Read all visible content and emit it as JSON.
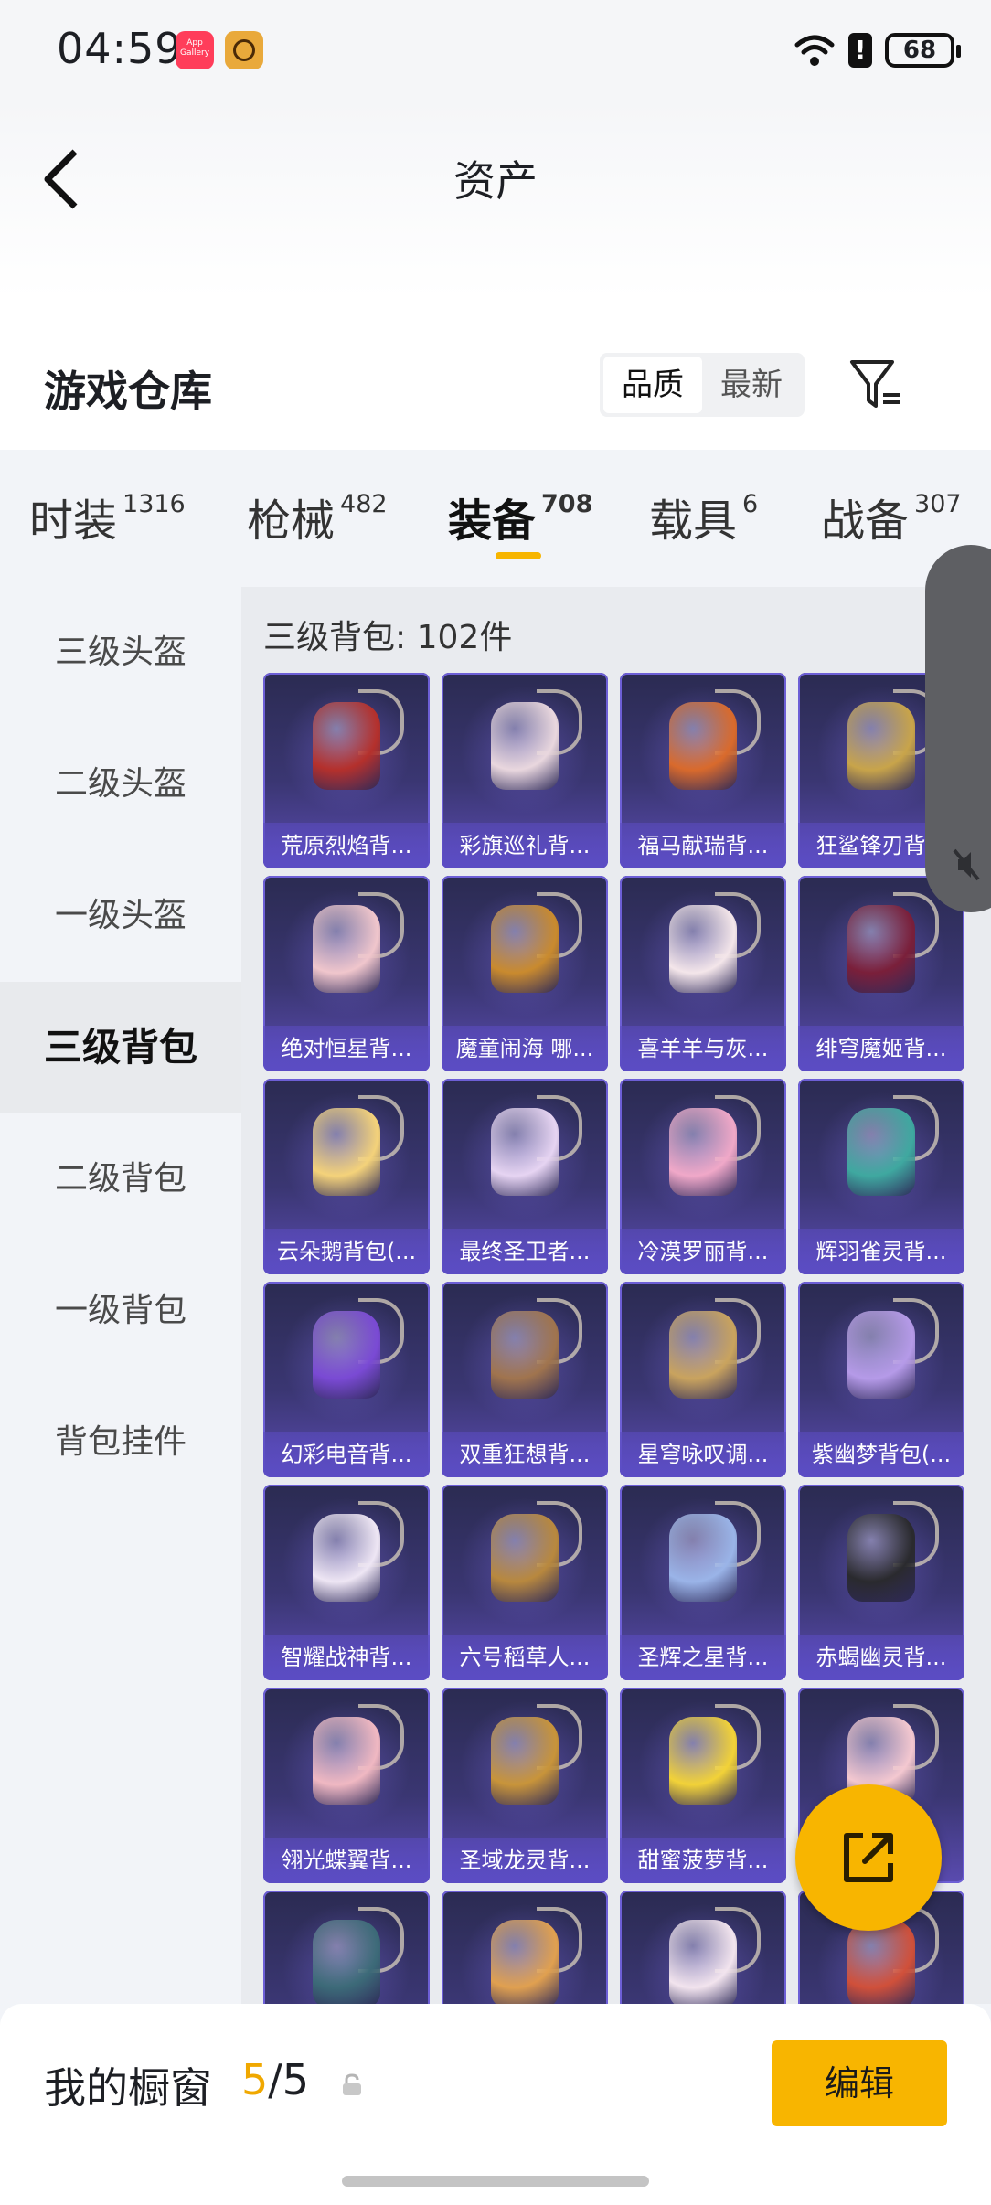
{
  "status_bar": {
    "time": "04:59",
    "app_icon_1": "App Gallery",
    "battery": "68"
  },
  "header": {
    "title": "资产"
  },
  "warehouse": {
    "title": "游戏仓库",
    "sort_options": [
      "品质",
      "最新"
    ]
  },
  "tabs": [
    {
      "label": "时装",
      "count": "1316"
    },
    {
      "label": "枪械",
      "count": "482"
    },
    {
      "label": "装备",
      "count": "708"
    },
    {
      "label": "载具",
      "count": "6"
    },
    {
      "label": "战备",
      "count": "307"
    }
  ],
  "sidenav": [
    "三级头盔",
    "二级头盔",
    "一级头盔",
    "三级背包",
    "二级背包",
    "一级背包",
    "背包挂件"
  ],
  "section_title": "三级背包: 102件",
  "items": [
    {
      "name": "荒原烈焰背...",
      "color": "#b4302c"
    },
    {
      "name": "彩旗巡礼背...",
      "color": "#e9d7de"
    },
    {
      "name": "福马献瑞背...",
      "color": "#d96a2c"
    },
    {
      "name": "狂鲨锋刃背...",
      "color": "#c8a44a"
    },
    {
      "name": "绝对恒星背...",
      "color": "#f0c6cc"
    },
    {
      "name": "魔童闹海 哪...",
      "color": "#c98a2e"
    },
    {
      "name": "喜羊羊与灰...",
      "color": "#f4e6ea"
    },
    {
      "name": "绯穹魔姬背...",
      "color": "#7a1f3a"
    },
    {
      "name": "云朵鹅背包(...",
      "color": "#f4d27a"
    },
    {
      "name": "最终圣卫者...",
      "color": "#e6d4f2"
    },
    {
      "name": "冷漠罗丽背...",
      "color": "#f0a8c8"
    },
    {
      "name": "辉羽雀灵背...",
      "color": "#3fa8a0"
    },
    {
      "name": "幻彩电音背...",
      "color": "#7a4ad4"
    },
    {
      "name": "双重狂想背...",
      "color": "#a0744e"
    },
    {
      "name": "星穹咏叹调...",
      "color": "#c9a35e"
    },
    {
      "name": "紫幽梦背包(...",
      "color": "#b59ae8"
    },
    {
      "name": "智耀战神背...",
      "color": "#eee6f4"
    },
    {
      "name": "六号稻草人...",
      "color": "#b8883e"
    },
    {
      "name": "圣辉之星背...",
      "color": "#9ab4e8"
    },
    {
      "name": "赤蝎幽灵背...",
      "color": "#2a2a2e"
    },
    {
      "name": "翎光蝶翼背...",
      "color": "#f0b8c2"
    },
    {
      "name": "圣域龙灵背...",
      "color": "#c8943a"
    },
    {
      "name": "甜蜜菠萝背...",
      "color": "#f2d238"
    },
    {
      "name": "",
      "color": "#f4c8d0"
    },
    {
      "name": "",
      "color": "#3c6a78"
    },
    {
      "name": "",
      "color": "#e0a050"
    },
    {
      "name": "",
      "color": "#f2e4ee"
    },
    {
      "name": "",
      "color": "#d0503a"
    }
  ],
  "bottom_bar": {
    "label": "我的橱窗",
    "current": "5",
    "total": "/5",
    "edit_label": "编辑"
  },
  "icons": {
    "back": "chevron-left-icon",
    "filter": "filter-icon",
    "share": "share-icon",
    "lock": "lock-icon",
    "mute": "mute-icon"
  },
  "colors": {
    "accent": "#f8b500",
    "card": "#3a3672"
  }
}
